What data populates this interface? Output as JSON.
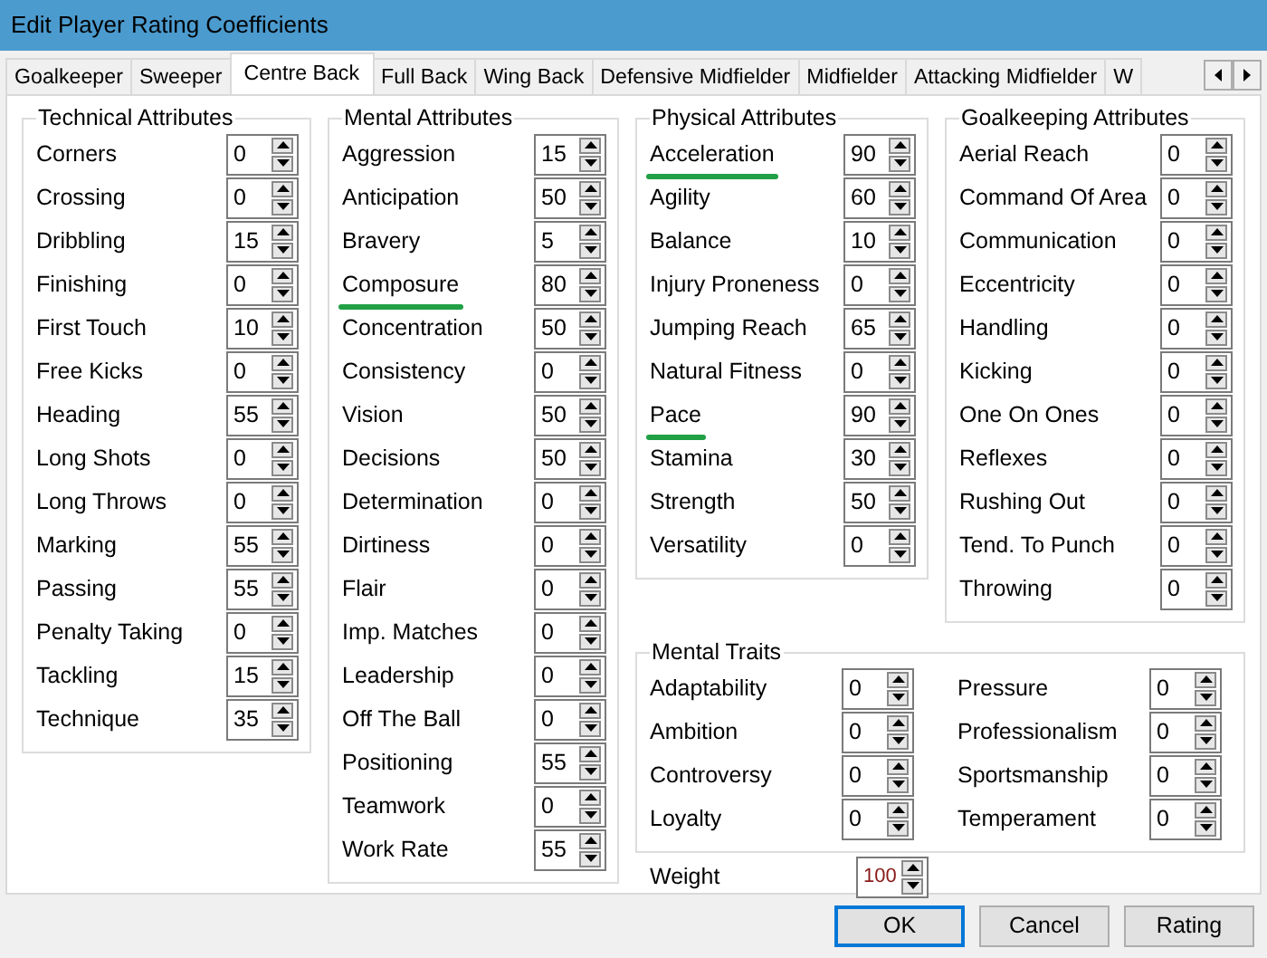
{
  "window": {
    "title": "Edit Player Rating Coefficients"
  },
  "tabs": [
    {
      "label": "Goalkeeper",
      "selected": false
    },
    {
      "label": "Sweeper",
      "selected": false
    },
    {
      "label": "Centre Back",
      "selected": true
    },
    {
      "label": "Full Back",
      "selected": false
    },
    {
      "label": "Wing Back",
      "selected": false
    },
    {
      "label": "Defensive Midfielder",
      "selected": false
    },
    {
      "label": "Midfielder",
      "selected": false
    },
    {
      "label": "Attacking Midfielder",
      "selected": false
    },
    {
      "label": "W",
      "selected": false
    }
  ],
  "groups": [
    {
      "title": "Technical Attributes",
      "fields": [
        {
          "label": "Corners",
          "value": "0",
          "highlighted": false
        },
        {
          "label": "Crossing",
          "value": "0",
          "highlighted": false
        },
        {
          "label": "Dribbling",
          "value": "15",
          "highlighted": false
        },
        {
          "label": "Finishing",
          "value": "0",
          "highlighted": false
        },
        {
          "label": "First Touch",
          "value": "10",
          "highlighted": false
        },
        {
          "label": "Free Kicks",
          "value": "0",
          "highlighted": false
        },
        {
          "label": "Heading",
          "value": "55",
          "highlighted": false
        },
        {
          "label": "Long Shots",
          "value": "0",
          "highlighted": false
        },
        {
          "label": "Long Throws",
          "value": "0",
          "highlighted": false
        },
        {
          "label": "Marking",
          "value": "55",
          "highlighted": false
        },
        {
          "label": "Passing",
          "value": "55",
          "highlighted": false
        },
        {
          "label": "Penalty Taking",
          "value": "0",
          "highlighted": false
        },
        {
          "label": "Tackling",
          "value": "15",
          "highlighted": false
        },
        {
          "label": "Technique",
          "value": "35",
          "highlighted": false
        }
      ]
    },
    {
      "title": "Mental Attributes",
      "fields": [
        {
          "label": "Aggression",
          "value": "15",
          "highlighted": false
        },
        {
          "label": "Anticipation",
          "value": "50",
          "highlighted": false
        },
        {
          "label": "Bravery",
          "value": "5",
          "highlighted": false
        },
        {
          "label": "Composure",
          "value": "80",
          "highlighted": true
        },
        {
          "label": "Concentration",
          "value": "50",
          "highlighted": false
        },
        {
          "label": "Consistency",
          "value": "0",
          "highlighted": false
        },
        {
          "label": "Vision",
          "value": "50",
          "highlighted": false
        },
        {
          "label": "Decisions",
          "value": "50",
          "highlighted": false
        },
        {
          "label": "Determination",
          "value": "0",
          "highlighted": false
        },
        {
          "label": "Dirtiness",
          "value": "0",
          "highlighted": false
        },
        {
          "label": "Flair",
          "value": "0",
          "highlighted": false
        },
        {
          "label": "Imp. Matches",
          "value": "0",
          "highlighted": false
        },
        {
          "label": "Leadership",
          "value": "0",
          "highlighted": false
        },
        {
          "label": "Off The Ball",
          "value": "0",
          "highlighted": false
        },
        {
          "label": "Positioning",
          "value": "55",
          "highlighted": false
        },
        {
          "label": "Teamwork",
          "value": "0",
          "highlighted": false
        },
        {
          "label": "Work Rate",
          "value": "55",
          "highlighted": false
        }
      ]
    },
    {
      "title": "Physical Attributes",
      "fields": [
        {
          "label": "Acceleration",
          "value": "90",
          "highlighted": true
        },
        {
          "label": "Agility",
          "value": "60",
          "highlighted": false
        },
        {
          "label": "Balance",
          "value": "10",
          "highlighted": false
        },
        {
          "label": "Injury Proneness",
          "value": "0",
          "highlighted": false
        },
        {
          "label": "Jumping Reach",
          "value": "65",
          "highlighted": false
        },
        {
          "label": "Natural Fitness",
          "value": "0",
          "highlighted": false
        },
        {
          "label": "Pace",
          "value": "90",
          "highlighted": true
        },
        {
          "label": "Stamina",
          "value": "30",
          "highlighted": false
        },
        {
          "label": "Strength",
          "value": "50",
          "highlighted": false
        },
        {
          "label": "Versatility",
          "value": "0",
          "highlighted": false
        }
      ]
    },
    {
      "title": "Goalkeeping Attributes",
      "fields": [
        {
          "label": "Aerial Reach",
          "value": "0",
          "highlighted": false
        },
        {
          "label": "Command Of Area",
          "value": "0",
          "highlighted": false
        },
        {
          "label": "Communication",
          "value": "0",
          "highlighted": false
        },
        {
          "label": "Eccentricity",
          "value": "0",
          "highlighted": false
        },
        {
          "label": "Handling",
          "value": "0",
          "highlighted": false
        },
        {
          "label": "Kicking",
          "value": "0",
          "highlighted": false
        },
        {
          "label": "One On Ones",
          "value": "0",
          "highlighted": false
        },
        {
          "label": "Reflexes",
          "value": "0",
          "highlighted": false
        },
        {
          "label": "Rushing Out",
          "value": "0",
          "highlighted": false
        },
        {
          "label": "Tend. To Punch",
          "value": "0",
          "highlighted": false
        },
        {
          "label": "Throwing",
          "value": "0",
          "highlighted": false
        }
      ]
    }
  ],
  "mental_traits": {
    "title": "Mental Traits",
    "fields": [
      {
        "label": "Adaptability",
        "value": "0",
        "highlighted": false
      },
      {
        "label": "Pressure",
        "value": "0",
        "highlighted": false
      },
      {
        "label": "Ambition",
        "value": "0",
        "highlighted": false
      },
      {
        "label": "Professionalism",
        "value": "0",
        "highlighted": false
      },
      {
        "label": "Controversy",
        "value": "0",
        "highlighted": false
      },
      {
        "label": "Sportsmanship",
        "value": "0",
        "highlighted": false
      },
      {
        "label": "Loyalty",
        "value": "0",
        "highlighted": false
      },
      {
        "label": "Temperament",
        "value": "0",
        "highlighted": false
      }
    ]
  },
  "weight": {
    "label": "Weight",
    "value": "100"
  },
  "buttons": [
    {
      "label": "OK",
      "default": true
    },
    {
      "label": "Cancel",
      "default": false
    },
    {
      "label": "Rating",
      "default": false
    }
  ]
}
